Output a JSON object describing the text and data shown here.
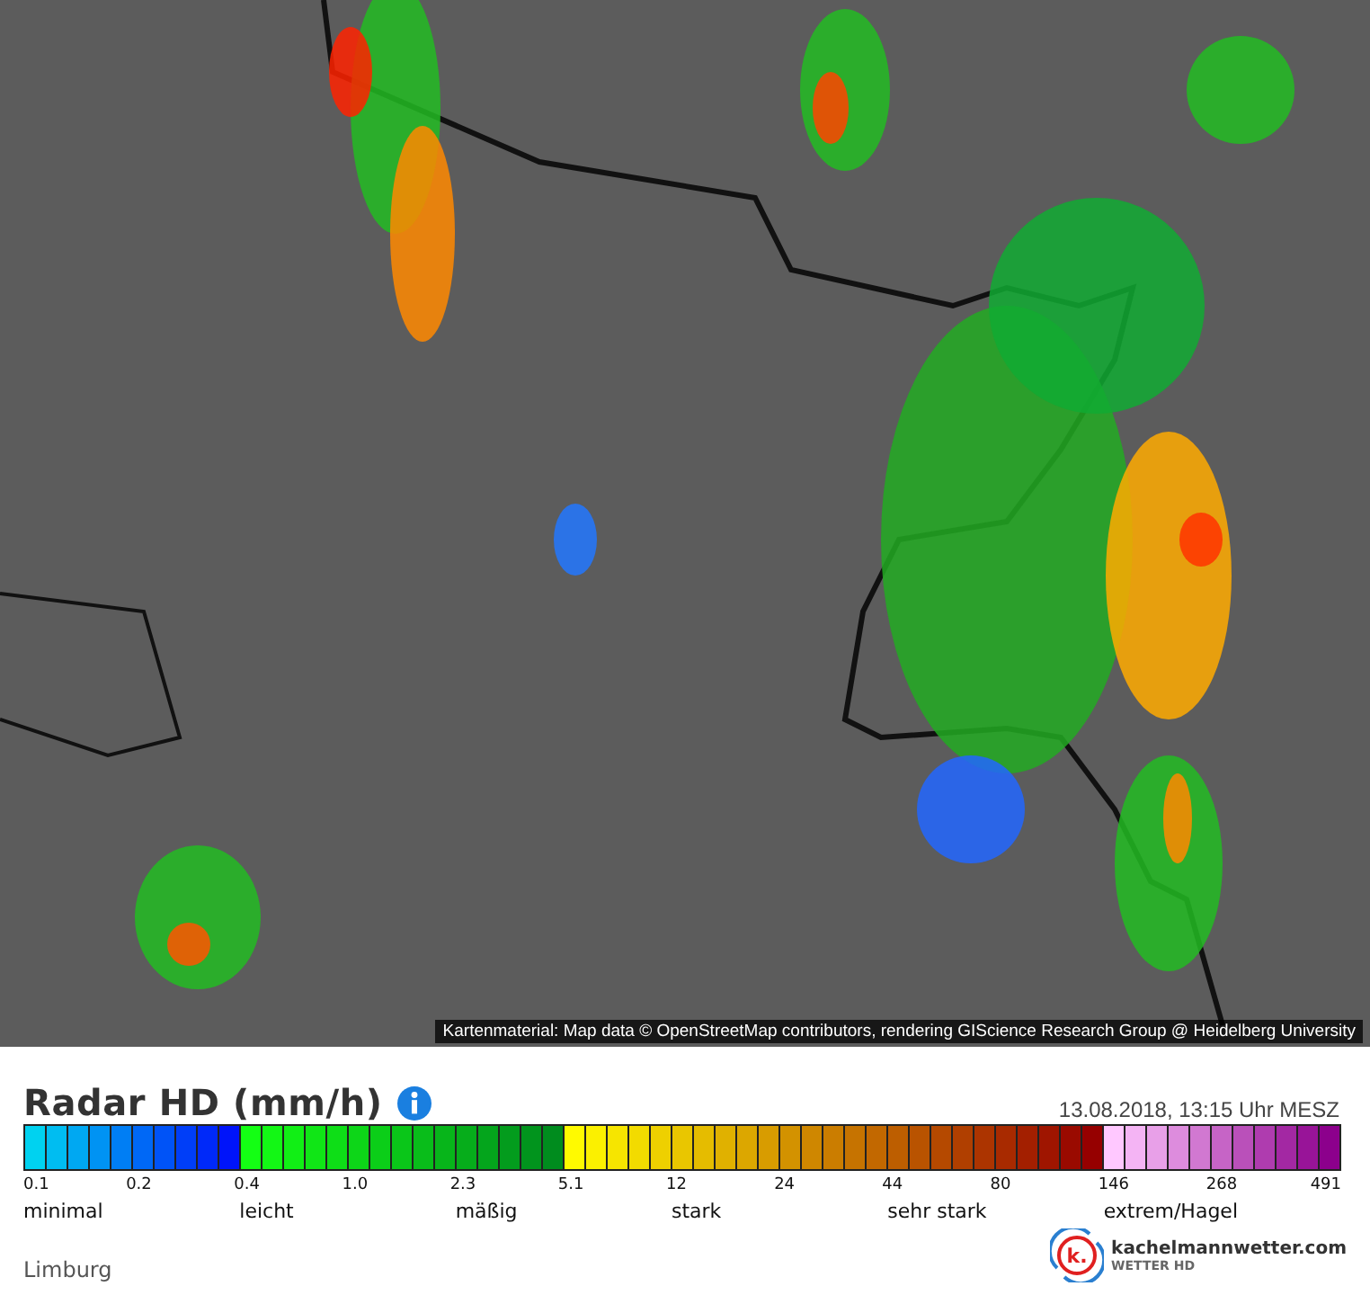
{
  "map": {
    "attribution": "Kartenmaterial: Map data © OpenStreetMap contributors, rendering GIScience Research Group @ Heidelberg University"
  },
  "legend": {
    "title": "Radar HD (mm/h)",
    "timestamp": "13.08.2018, 13:15 Uhr MESZ",
    "ticks": [
      "0.1",
      "0.2",
      "0.4",
      "1.0",
      "2.3",
      "5.1",
      "12",
      "24",
      "44",
      "80",
      "146",
      "268",
      "491"
    ],
    "categories": [
      "minimal",
      "leicht",
      "mäßig",
      "stark",
      "sehr stark",
      "extrem/Hagel"
    ]
  },
  "region": "Limburg",
  "brand": {
    "name": "kachelmannwetter.com",
    "tagline": "WETTER HD",
    "logo_letter": "k."
  }
}
